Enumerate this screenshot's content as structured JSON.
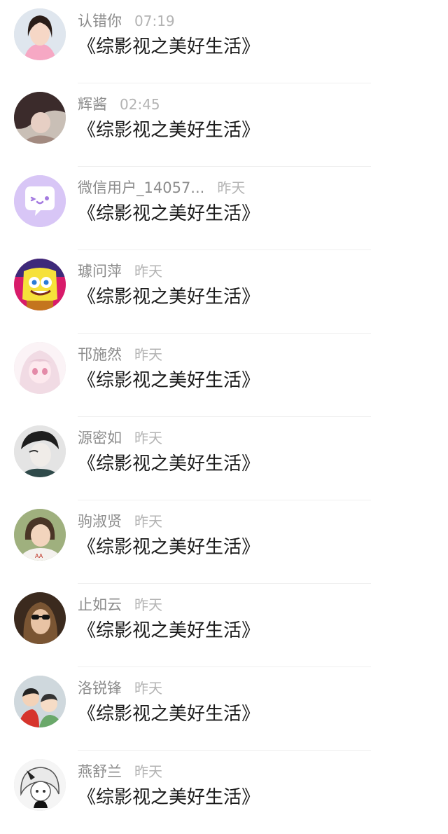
{
  "messages": [
    {
      "name": "认错你",
      "time": "07:19",
      "text": "《综影视之美好生活》",
      "avatar": "avatar-girl-pink"
    },
    {
      "name": "辉酱",
      "time": "02:45",
      "text": "《综影视之美好生活》",
      "avatar": "avatar-woman-dark"
    },
    {
      "name": "微信用户_14057...",
      "time": "昨天",
      "text": "《综影视之美好生活》",
      "avatar": "avatar-default-wechat"
    },
    {
      "name": "璩问萍",
      "time": "昨天",
      "text": "《综影视之美好生活》",
      "avatar": "avatar-spongebob"
    },
    {
      "name": "邗施然",
      "time": "昨天",
      "text": "《综影视之美好生活》",
      "avatar": "avatar-anime-girl"
    },
    {
      "name": "源密如",
      "time": "昨天",
      "text": "《综影视之美好生活》",
      "avatar": "avatar-boy-sketch"
    },
    {
      "name": "驹淑贤",
      "time": "昨天",
      "text": "《综影视之美好生活》",
      "avatar": "avatar-girl-selfie"
    },
    {
      "name": "止如云",
      "time": "昨天",
      "text": "《综影视之美好生活》",
      "avatar": "avatar-woman-sunglasses"
    },
    {
      "name": "洛锐锋",
      "time": "昨天",
      "text": "《综影视之美好生活》",
      "avatar": "avatar-two-kids"
    },
    {
      "name": "燕舒兰",
      "time": "昨天",
      "text": "《综影视之美好生活》",
      "avatar": "avatar-anime-sketch"
    }
  ]
}
